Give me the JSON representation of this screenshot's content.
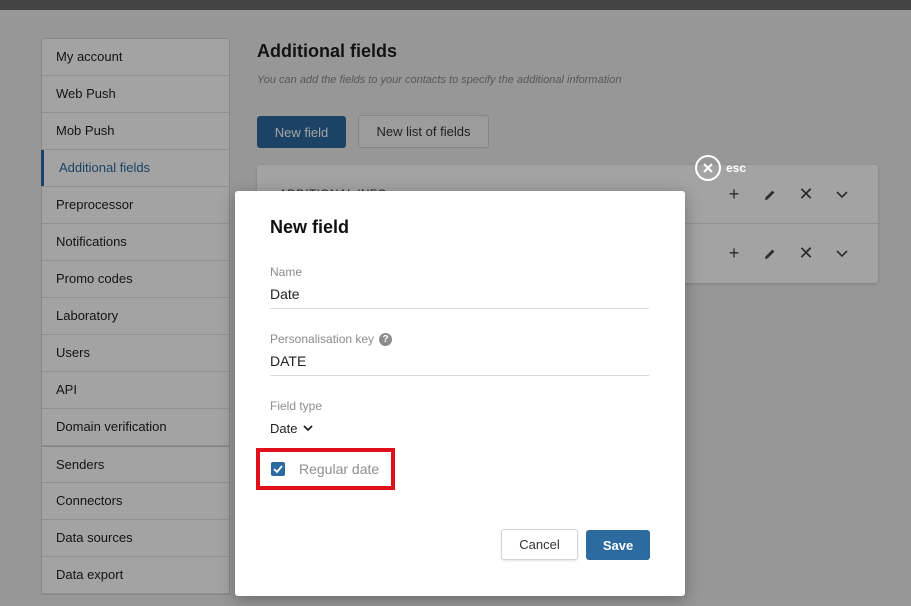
{
  "sidebar": {
    "items": [
      {
        "label": "My account"
      },
      {
        "label": "Web Push"
      },
      {
        "label": "Mob Push"
      },
      {
        "label": "Additional fields"
      },
      {
        "label": "Preprocessor"
      },
      {
        "label": "Notifications"
      },
      {
        "label": "Promo codes"
      },
      {
        "label": "Laboratory"
      },
      {
        "label": "Users"
      },
      {
        "label": "API"
      },
      {
        "label": "Domain verification"
      },
      {
        "label": "Senders"
      },
      {
        "label": "Connectors"
      },
      {
        "label": "Data sources"
      },
      {
        "label": "Data export"
      }
    ],
    "active": "Additional fields"
  },
  "main": {
    "title": "Additional fields",
    "subtitle": "You can add the fields to your contacts to specify the additional information",
    "new_field_button": "New field",
    "new_list_button": "New list of fields",
    "rows": [
      {
        "title": "ADDITIONAL INFO"
      },
      {
        "title": ""
      }
    ]
  },
  "close": {
    "label": "esc"
  },
  "modal": {
    "title": "New field",
    "name_label": "Name",
    "name_value": "Date",
    "key_label": "Personalisation key",
    "key_value": "DATE",
    "type_label": "Field type",
    "type_value": "Date",
    "checkbox_label": "Regular date",
    "checkbox_checked": true,
    "cancel_button": "Cancel",
    "save_button": "Save"
  },
  "colors": {
    "accent": "#2c6aa0",
    "highlight": "#e0101a"
  }
}
